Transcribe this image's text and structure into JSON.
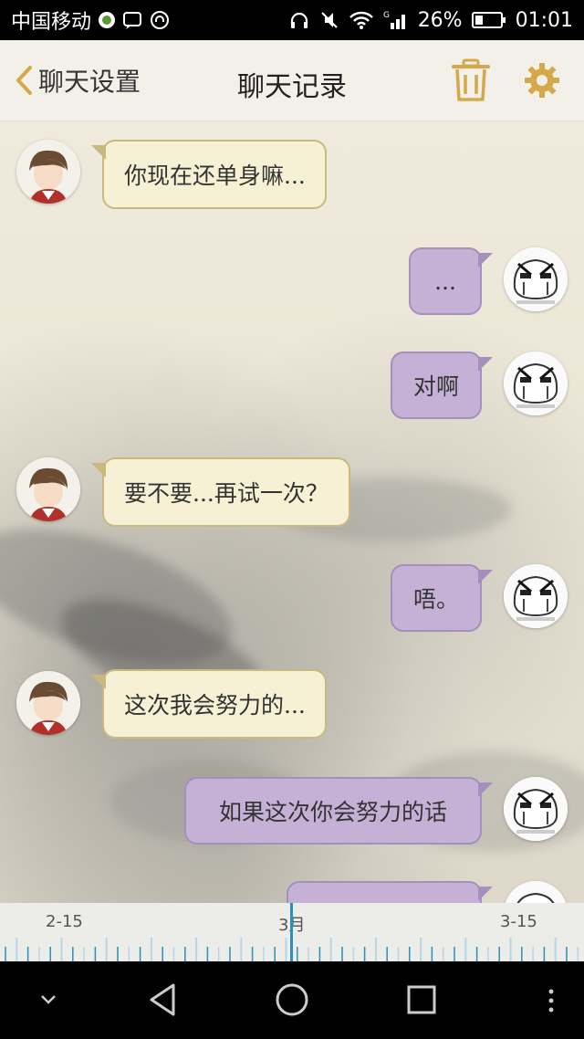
{
  "status_bar": {
    "carrier": "中国移动",
    "battery": "26%",
    "time": "01:01"
  },
  "header": {
    "back_label": "聊天设置",
    "title": "聊天记录",
    "icons": [
      "trash-icon",
      "gear-icon"
    ]
  },
  "messages": [
    {
      "side": "in",
      "text": "你现在还单身嘛..."
    },
    {
      "side": "out",
      "text": "..."
    },
    {
      "side": "out",
      "text": "对啊"
    },
    {
      "side": "in",
      "text": "要不要...再试一次？"
    },
    {
      "side": "out",
      "text": "唔。"
    },
    {
      "side": "in",
      "text": "这次我会努力的..."
    },
    {
      "side": "out",
      "text": "如果这次你会努力的话"
    }
  ],
  "timeline": {
    "labels": [
      "2-15",
      "3月",
      "3-15"
    ]
  },
  "nav": {
    "icons": [
      "chevron-down-icon",
      "back-triangle-icon",
      "home-circle-icon",
      "recents-square-icon",
      "more-dots-icon"
    ]
  },
  "colors": {
    "incoming_bubble": "#f6f0d4",
    "outgoing_bubble": "#c5b1d6",
    "accent_gold": "#d4a94a",
    "timeline_accent": "#2a8fbd"
  }
}
